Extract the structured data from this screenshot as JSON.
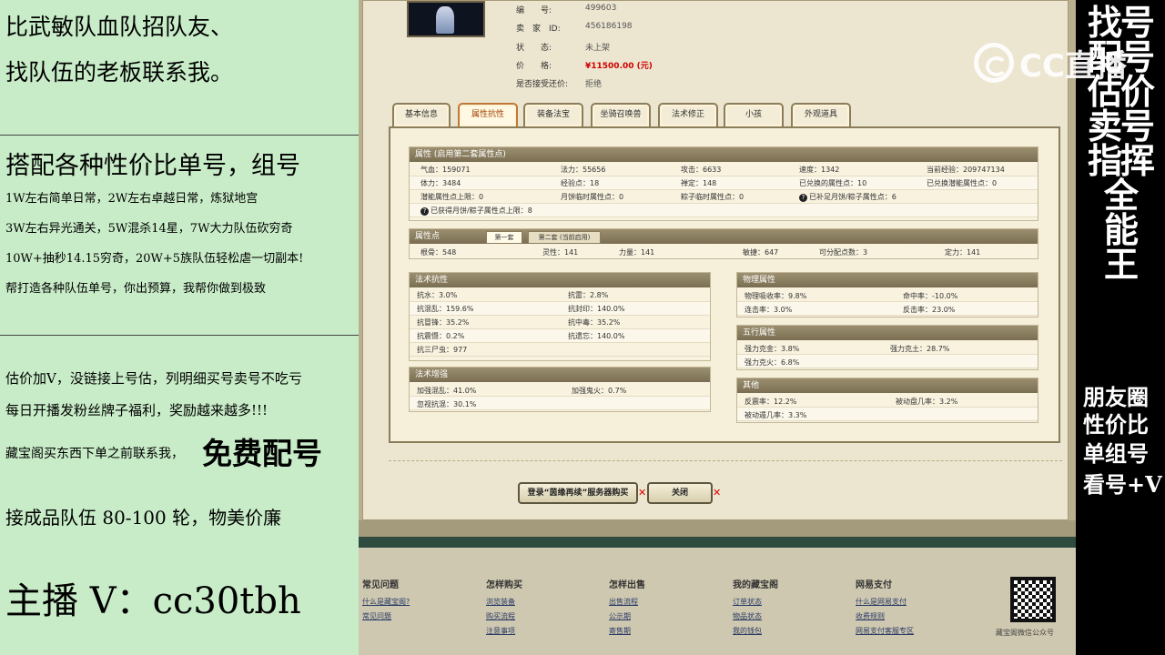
{
  "left": {
    "line1": "比武敏队血队招队友、",
    "line2": "找队伍的老板联系我。",
    "line3": "搭配各种性价比单号，组号",
    "line4": "1W左右简单日常，2W左右卓越日常，炼狱地宫",
    "line5": "3W左右异光通关，5W混杀14星，7W大力队伍砍穷奇",
    "line6": "10W+抽秒14.15穷奇，20W+5族队伍轻松虐一切副本!",
    "line7": "帮打造各种队伍单号，你出预算，我帮你做到极致",
    "line8": "估价加V，没链接上号估，列明细买号卖号不吃亏",
    "line9": "每日开播发粉丝牌子福利，奖励越来越多!!!",
    "line10a": "藏宝阁买东西下单之前联系我，",
    "line10b": "免费配号",
    "line11": "接成品队伍 80-100 轮，物美价廉",
    "line12": "主播 V：cc30tbh"
  },
  "right": {
    "big": "找号\n配号\n估价\n卖号\n指挥\n全\n能\n王",
    "small1": "朋友圈",
    "small2": "性价比",
    "small3": "单组号",
    "small4": "看号+V"
  },
  "logo": "CC直播",
  "info": {
    "id_label": "编　　号:",
    "id_value": "499603",
    "seller_label": "卖　家　ID:",
    "seller_value": "456186198",
    "status_label": "状　　态:",
    "status_value": "未上架",
    "price_label": "价　　格:",
    "price_value": "¥11500.00 (元)",
    "bargain_label": "是否接受还价:",
    "bargain_value": "拒绝"
  },
  "tabs": [
    "基本信息",
    "属性抗性",
    "装备法宝",
    "坐骑召唤兽",
    "法术修正",
    "小孩",
    "外观道具"
  ],
  "attr": {
    "title": "属性 (启用第二套属性点)",
    "cells": [
      "气血：159071",
      "法力：55656",
      "攻击：6633",
      "速度：1342",
      "当前经验：209747134",
      "体力：3484",
      "经验点：18",
      "禅定：148",
      "已兑换的属性点：10",
      "已兑换潜能属性点：0",
      "潜能属性点上限：0",
      "月饼临时属性点：0",
      "粽子临时属性点：0",
      "已补足月饼/粽子属性点：6",
      "已获得月饼/粽子属性点上限：8"
    ]
  },
  "points": {
    "title": "属性点",
    "tab1": "第一套",
    "tab2": "第二套 (当前启用)",
    "cells": [
      "根骨：548",
      "灵性：141",
      "力量：141",
      "敏捷：647",
      "可分配点数：3",
      "定力：141"
    ]
  },
  "resist": {
    "title": "法术抗性",
    "cells": [
      "抗水：3.0%",
      "抗雷：2.8%",
      "抗混乱：159.6%",
      "抗封印：140.0%",
      "抗冒锋：35.2%",
      "抗中毒：35.2%",
      "抗震慑：0.2%",
      "抗遗忘：140.0%",
      "抗三尸虫：977"
    ]
  },
  "enhance": {
    "title": "法术增强",
    "cells": [
      "加强混乱：41.0%",
      "加强鬼火：0.7%",
      "忽视抗混：30.1%"
    ]
  },
  "physical": {
    "title": "物理属性",
    "cells": [
      "物理吸收率：9.8%",
      "命中率：-10.0%",
      "连击率：3.0%",
      "反击率：23.0%"
    ]
  },
  "five": {
    "title": "五行属性",
    "cells": [
      "强力克金：3.8%",
      "强力克土：28.7%",
      "强力克火：6.8%"
    ]
  },
  "other": {
    "title": "其他",
    "cells": [
      "反震率：12.2%",
      "被动盘几率：3.2%",
      "被动遁几率：3.3%"
    ]
  },
  "buttons": {
    "login": "登录“茵缘再续”服务器购买",
    "close": "关闭"
  },
  "footer": {
    "cols": [
      {
        "title": "常见问题",
        "links": [
          "什么是藏宝阁?",
          "常见问题"
        ]
      },
      {
        "title": "怎样购买",
        "links": [
          "浏览装备",
          "购买流程",
          "注意事项"
        ]
      },
      {
        "title": "怎样出售",
        "links": [
          "出售流程",
          "公示期",
          "寄售期"
        ]
      },
      {
        "title": "我的藏宝阁",
        "links": [
          "订单状态",
          "物品状态",
          "我的钱包"
        ]
      },
      {
        "title": "网易支付",
        "links": [
          "什么是网易支付",
          "收费规则",
          "网易支付客服专区"
        ]
      }
    ],
    "qr_caption": "藏宝阁微信公众号"
  }
}
